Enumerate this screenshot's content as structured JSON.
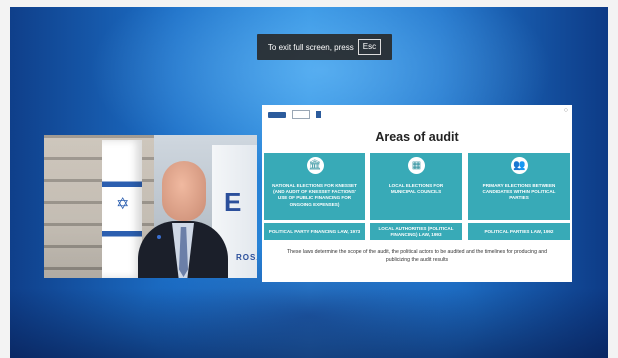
{
  "overlay": {
    "exit_text": "To exit full screen, press",
    "key_label": "Esc"
  },
  "video": {
    "banner_logo": "E",
    "banner_text": "ROSA"
  },
  "slide": {
    "title": "Areas of audit",
    "cards": [
      {
        "icon": "bank-icon",
        "text": "NATIONAL ELECTIONS FOR KNESSET (AND AUDIT OF KNESSET FACTIONS' USE OF PUBLIC FINANCING FOR ONGOING EXPENSES)",
        "law": "POLITICAL PARTY FINANCING LAW, 1973"
      },
      {
        "icon": "building-icon",
        "text": "LOCAL ELECTIONS FOR MUNICIPAL COUNCILS",
        "law": "LOCAL AUTHORITIES (POLITICAL FINANCING) LAW, 1993"
      },
      {
        "icon": "people-icon",
        "text": "PRIMARY ELECTIONS BETWEEN CANDIDATES WITHIN POLITICAL PARTIES",
        "law": "POLITICAL PARTIES LAW, 1992"
      }
    ],
    "footer": "These laws determine the scope of the audit, the political actors to be audited and the timelines for producing and publicizing the audit results"
  },
  "colors": {
    "card": "#38aab7",
    "background": "#1c6fc7"
  }
}
